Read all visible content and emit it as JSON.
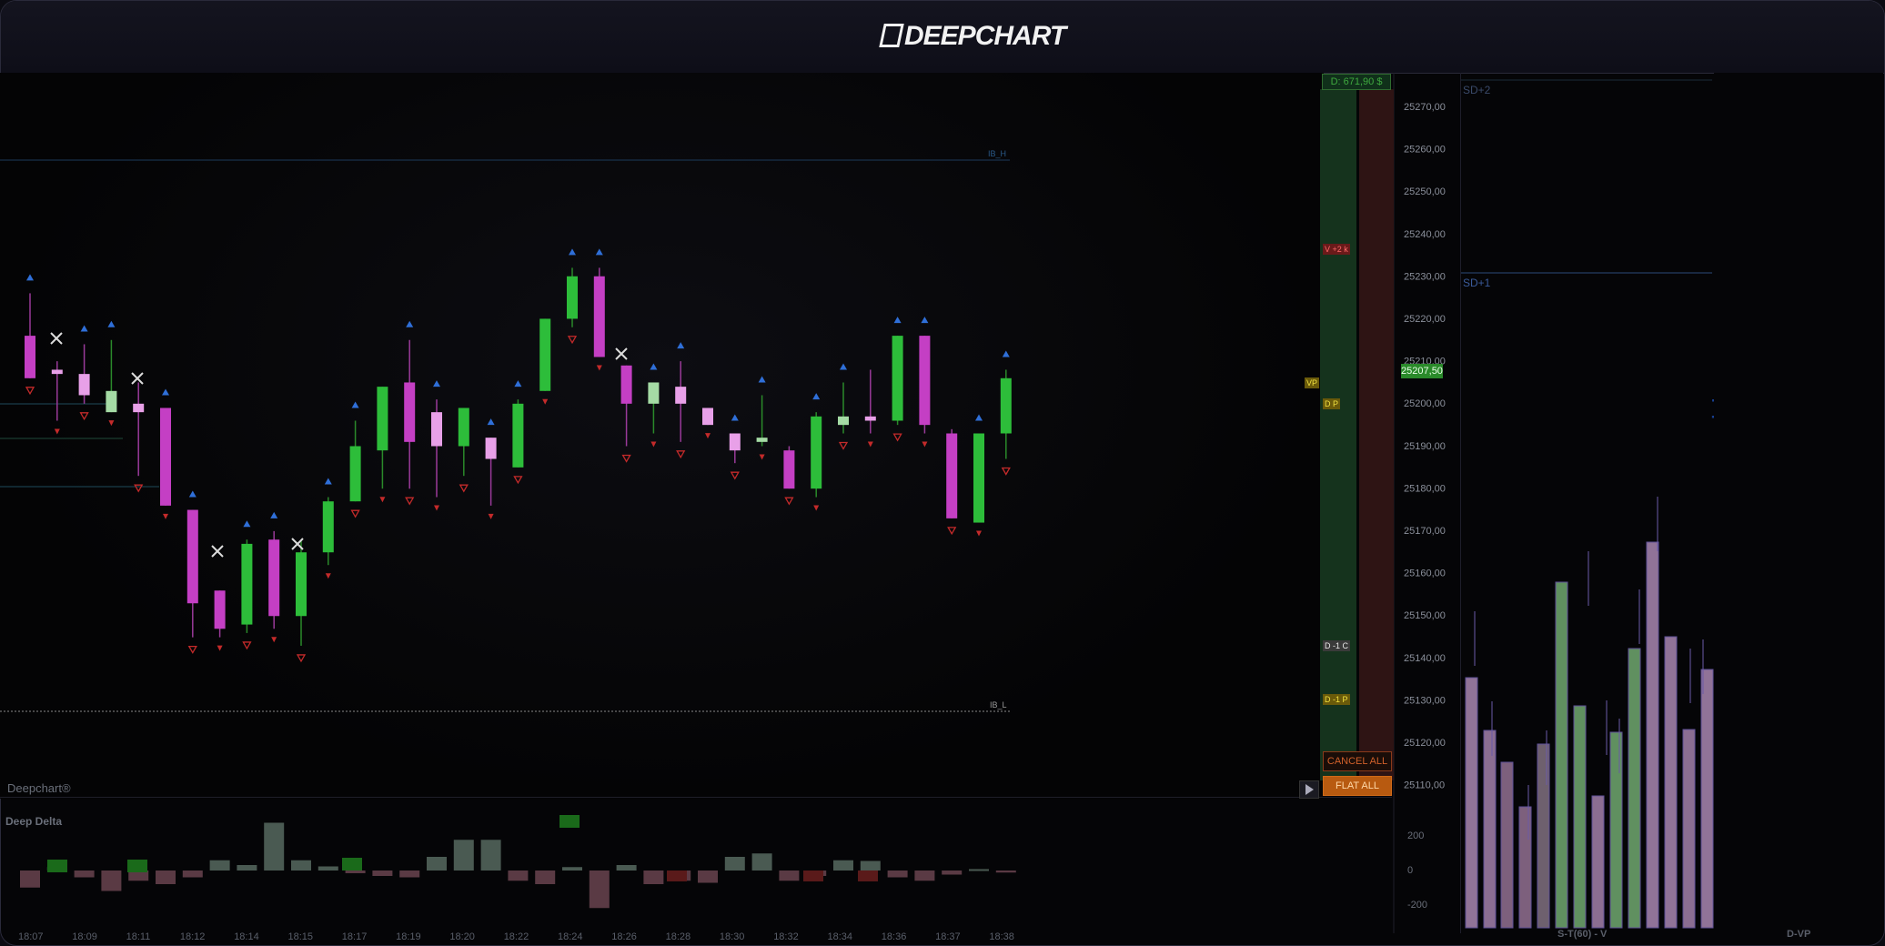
{
  "app": {
    "title": "DEEPCHART"
  },
  "main": {
    "watermark": "Deepchart®",
    "indicator_label": "Deep Delta",
    "ib_high_label": "IB_H",
    "ib_low_label": "IB_L",
    "time_labels": [
      "18:07",
      "18:09",
      "18:11",
      "18:12",
      "18:14",
      "18:15",
      "18:17",
      "18:19",
      "18:20",
      "18:22",
      "18:24",
      "18:26",
      "18:28",
      "18:30",
      "18:32",
      "18:34",
      "18:36",
      "18:37",
      "18:38"
    ],
    "delta_axis_labels": [
      "200",
      "0",
      "-200"
    ]
  },
  "price_axis": {
    "labels": [
      "25270,00",
      "25260,00",
      "25250,00",
      "25240,00",
      "25230,00",
      "25220,00",
      "25210,00",
      "25200,00",
      "25190,00",
      "25180,00",
      "25170,00",
      "25160,00",
      "25150,00",
      "25140,00",
      "25130,00",
      "25120,00",
      "25110,00"
    ],
    "current_price": "25207,50"
  },
  "dom": {
    "pnl": "D: 671,90 $",
    "tags": [
      "V +2 k",
      "D P",
      "D -1 C",
      "D -1 P",
      "VP"
    ],
    "cancel_all": "CANCEL ALL",
    "flat_all": "FLAT ALL"
  },
  "st_panel": {
    "sd_plus2": "SD+2",
    "sd_plus1": "SD+1",
    "footer": "S-T(60) - V"
  },
  "vp_panel": {
    "footer": "D-VP"
  },
  "colors": {
    "bull_strong": "#2dbd3a",
    "bull_weak": "#a5dba5",
    "bear_strong": "#c43fc4",
    "bear_weak": "#e8a0e8",
    "accent_blue": "#2f6fd8",
    "poc_yellow": "#d4c22a"
  },
  "chart_data": {
    "type": "candlestick",
    "time": [
      "18:07",
      "18:09",
      "18:11",
      "18:12",
      "18:14",
      "18:15",
      "18:17",
      "18:19",
      "18:20",
      "18:22",
      "18:24",
      "18:26",
      "18:28",
      "18:30",
      "18:32",
      "18:34",
      "18:36",
      "18:37",
      "18:38"
    ],
    "candles": [
      {
        "o": 25216,
        "h": 25226,
        "l": 25209,
        "c": 25206,
        "t": "bear"
      },
      {
        "o": 25208,
        "h": 25210,
        "l": 25196,
        "c": 25207,
        "t": "bear"
      },
      {
        "o": 25207,
        "h": 25214,
        "l": 25200,
        "c": 25202,
        "t": "bear"
      },
      {
        "o": 25198,
        "h": 25215,
        "l": 25198,
        "c": 25203,
        "t": "bull"
      },
      {
        "o": 25200,
        "h": 25205,
        "l": 25183,
        "c": 25198,
        "t": "bear"
      },
      {
        "o": 25199,
        "h": 25199,
        "l": 25177,
        "c": 25176,
        "t": "bear"
      },
      {
        "o": 25175,
        "h": 25175,
        "l": 25145,
        "c": 25153,
        "t": "bear"
      },
      {
        "o": 25156,
        "h": 25156,
        "l": 25145,
        "c": 25147,
        "t": "bear"
      },
      {
        "o": 25148,
        "h": 25168,
        "l": 25146,
        "c": 25167,
        "t": "bull"
      },
      {
        "o": 25168,
        "h": 25170,
        "l": 25147,
        "c": 25150,
        "t": "bear"
      },
      {
        "o": 25150,
        "h": 25168,
        "l": 25143,
        "c": 25165,
        "t": "bull"
      },
      {
        "o": 25165,
        "h": 25178,
        "l": 25162,
        "c": 25177,
        "t": "bull"
      },
      {
        "o": 25177,
        "h": 25196,
        "l": 25177,
        "c": 25190,
        "t": "bull"
      },
      {
        "o": 25189,
        "h": 25204,
        "l": 25180,
        "c": 25204,
        "t": "bull"
      },
      {
        "o": 25205,
        "h": 25215,
        "l": 25180,
        "c": 25191,
        "t": "bear"
      },
      {
        "o": 25198,
        "h": 25201,
        "l": 25178,
        "c": 25190,
        "t": "bear"
      },
      {
        "o": 25190,
        "h": 25190,
        "l": 25183,
        "c": 25199,
        "t": "bull"
      },
      {
        "o": 25192,
        "h": 25192,
        "l": 25176,
        "c": 25187,
        "t": "bear"
      },
      {
        "o": 25185,
        "h": 25201,
        "l": 25185,
        "c": 25200,
        "t": "bull"
      },
      {
        "o": 25203,
        "h": 25219,
        "l": 25203,
        "c": 25220,
        "t": "bull"
      },
      {
        "o": 25230,
        "h": 25232,
        "l": 25218,
        "c": 25220,
        "t": "bull"
      },
      {
        "o": 25230,
        "h": 25232,
        "l": 25214,
        "c": 25211,
        "t": "bear"
      },
      {
        "o": 25209,
        "h": 25209,
        "l": 25190,
        "c": 25200,
        "t": "bear"
      },
      {
        "o": 25205,
        "h": 25205,
        "l": 25193,
        "c": 25200,
        "t": "bull"
      },
      {
        "o": 25204,
        "h": 25210,
        "l": 25191,
        "c": 25200,
        "t": "bear"
      },
      {
        "o": 25199,
        "h": 25199,
        "l": 25195,
        "c": 25195,
        "t": "bear"
      },
      {
        "o": 25193,
        "h": 25193,
        "l": 25186,
        "c": 25189,
        "t": "bear"
      },
      {
        "o": 25192,
        "h": 25202,
        "l": 25190,
        "c": 25191,
        "t": "bull"
      },
      {
        "o": 25189,
        "h": 25190,
        "l": 25180,
        "c": 25180,
        "t": "bear"
      },
      {
        "o": 25180,
        "h": 25198,
        "l": 25178,
        "c": 25197,
        "t": "bull"
      },
      {
        "o": 25197,
        "h": 25205,
        "l": 25193,
        "c": 25195,
        "t": "bull"
      },
      {
        "o": 25197,
        "h": 25208,
        "l": 25193,
        "c": 25196,
        "t": "bear"
      },
      {
        "o": 25196,
        "h": 25216,
        "l": 25195,
        "c": 25216,
        "t": "bull"
      },
      {
        "o": 25216,
        "h": 25216,
        "l": 25193,
        "c": 25195,
        "t": "bear"
      },
      {
        "o": 25193,
        "h": 25194,
        "l": 25173,
        "c": 25173,
        "t": "bear"
      },
      {
        "o": 25172,
        "h": 25193,
        "l": 25172,
        "c": 25193,
        "t": "bull"
      },
      {
        "o": 25193,
        "h": 25208,
        "l": 25187,
        "c": 25206,
        "t": "bull"
      }
    ],
    "ylim": [
      25105,
      25275
    ]
  }
}
